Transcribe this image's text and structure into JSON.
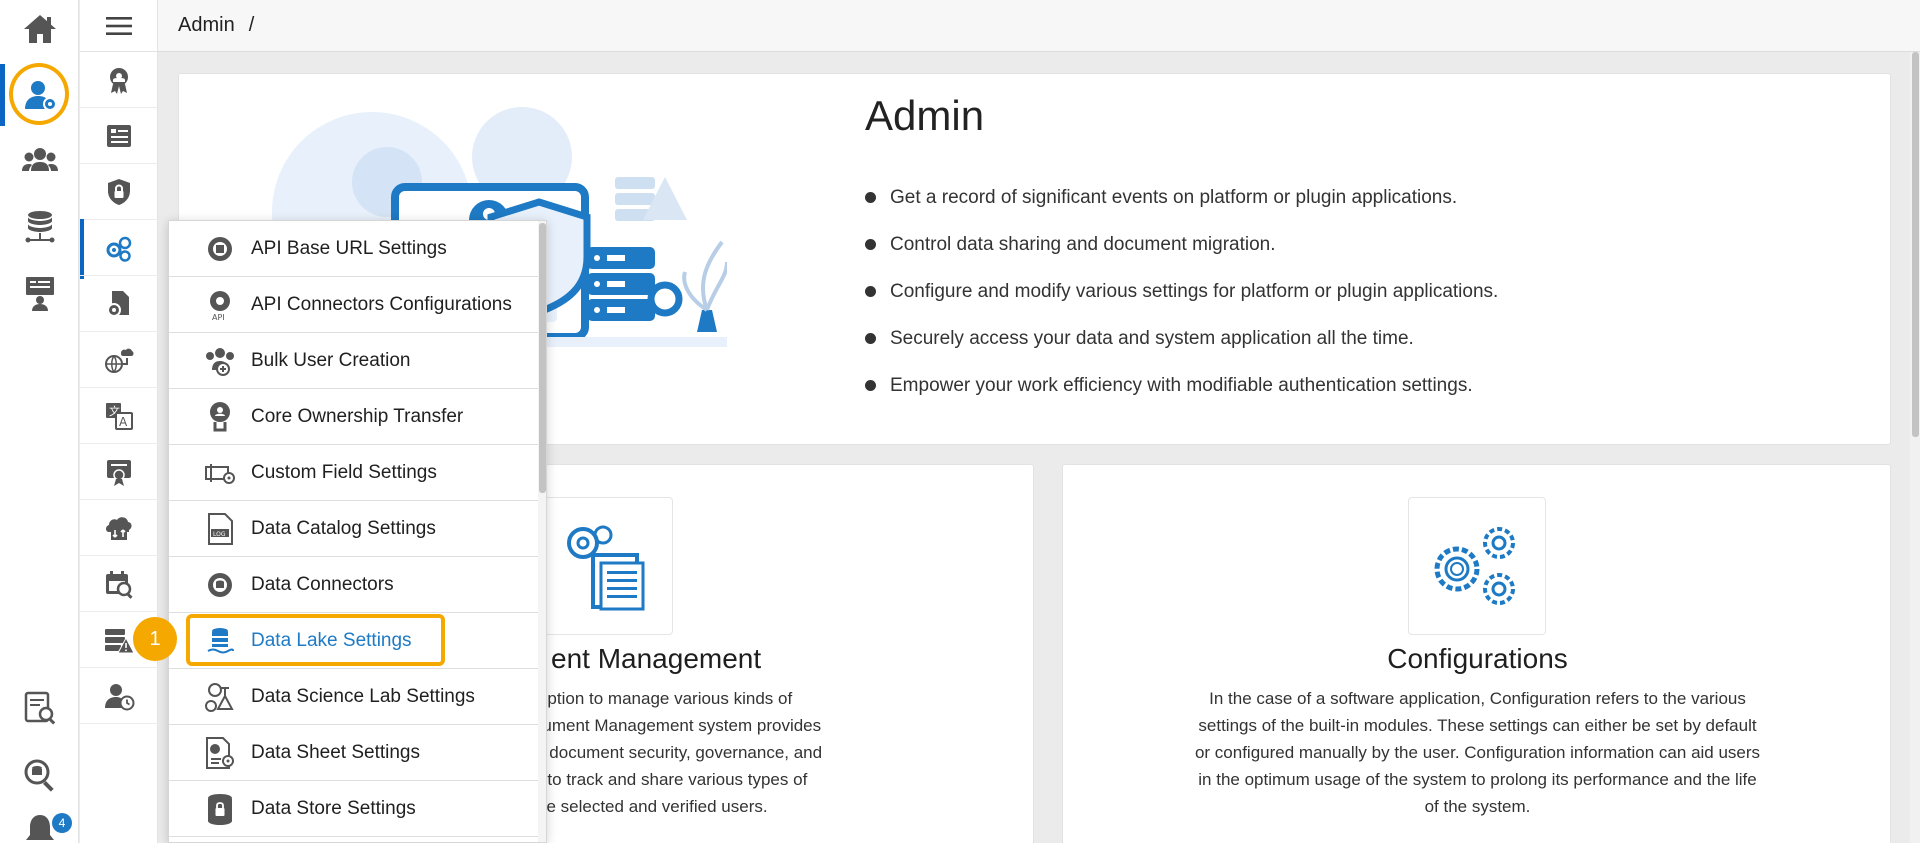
{
  "breadcrumb": {
    "current": "Admin",
    "separator": "/"
  },
  "rail": {
    "items": [
      "home-icon",
      "admin-user-gear-icon",
      "groups-icon",
      "database-icon",
      "presentation-icon",
      "report-search-icon",
      "data-search-icon",
      "notifications-icon"
    ],
    "notification_count": "4"
  },
  "col2": {
    "items": [
      "certificate-icon",
      "audit-list-icon",
      "security-lock-icon",
      "configurations-gear-icon",
      "document-gear-icon",
      "cloud-transfer-icon",
      "translate-icon",
      "license-icon",
      "cloud-download-icon",
      "calendar-search-icon",
      "server-alert-icon",
      "user-clock-icon"
    ]
  },
  "hero": {
    "title": "Admin",
    "bullets": [
      "Get a record of significant events on platform or plugin applications.",
      "Control data sharing and document migration.",
      "Configure and modify various settings for platform or plugin applications.",
      "Securely access your data and system application all the time.",
      "Empower your work efficiency with modifiable authentication settings."
    ]
  },
  "cards": {
    "document": {
      "title": "ent Management",
      "lines": [
        "n in-built option to manage various kinds of",
        ". The Document Management system provides",
        "n terms of document security, governance, and",
        "e. It helps to track and share various types of",
        "ers with the selected and verified users."
      ]
    },
    "configurations": {
      "title": "Configurations",
      "lines": [
        "In the case of a software application, Configuration refers to the various",
        "settings of the built-in modules. These settings can either be set by default",
        "or configured manually by the user. Configuration information can aid users",
        "in the optimum usage of the system to prolong its performance and the life",
        "of the system."
      ]
    }
  },
  "dropdown": {
    "items": [
      {
        "label": "API Base URL Settings",
        "icon": "api-gear-icon"
      },
      {
        "label": "API Connectors Configurations",
        "icon": "api-connector-icon"
      },
      {
        "label": "Bulk User Creation",
        "icon": "bulk-users-icon"
      },
      {
        "label": "Core Ownership Transfer",
        "icon": "ownership-transfer-icon"
      },
      {
        "label": "Custom Field Settings",
        "icon": "custom-field-icon"
      },
      {
        "label": "Data Catalog Settings",
        "icon": "data-catalog-icon"
      },
      {
        "label": "Data Connectors",
        "icon": "data-connectors-icon"
      },
      {
        "label": "Data Lake Settings",
        "icon": "data-lake-icon"
      },
      {
        "label": "Data Science Lab Settings",
        "icon": "data-science-lab-icon"
      },
      {
        "label": "Data Sheet Settings",
        "icon": "data-sheet-icon"
      },
      {
        "label": "Data Store Settings",
        "icon": "data-store-icon"
      }
    ],
    "active_index": 7
  },
  "annotation": {
    "step": "1"
  },
  "colors": {
    "accent": "#1e7ac4",
    "highlight": "#f5a800",
    "icon_gray": "#4a4a4a"
  }
}
